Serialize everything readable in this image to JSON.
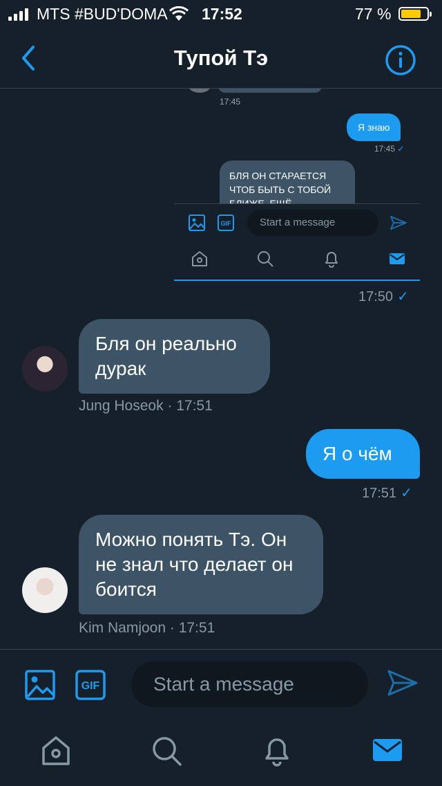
{
  "status_bar": {
    "carrier": "MTS #BUD'DOMA",
    "time": "17:52",
    "battery_percent": "77 %",
    "battery_level": 0.77,
    "signal_bars": 4
  },
  "header": {
    "title": "Тупой Тэ",
    "back_icon": "chevron-left-icon",
    "info_icon": "info-icon"
  },
  "embedded_screenshot": {
    "time_1": "17:45",
    "my_message": "Я знаю",
    "time_2": "17:45",
    "tick": "✓",
    "long_message": "БЛЯ ОН СТАРАЕТСЯ ЧТОБ БЫТЬ С ТОБОЙ БЛИЖЕ. ЕЩЁ",
    "input_placeholder": "Start a message"
  },
  "messages": [
    {
      "time": "17:50",
      "tick": "✓"
    },
    {
      "text": "Бля он реально дурак",
      "meta": "Jung Hoseok · 17:51"
    },
    {
      "text": "Я о чём",
      "time": "17:51",
      "tick": "✓"
    },
    {
      "text": "Можно понять Тэ. Он не знал что делает он боится",
      "meta": "Kim Namjoon · 17:51"
    }
  ],
  "composer": {
    "placeholder": "Start a message",
    "gif_label": "GIF"
  },
  "tabbar": {
    "items": [
      "home-icon",
      "search-icon",
      "bell-icon",
      "mail-icon"
    ],
    "active": "mail-icon"
  },
  "colors": {
    "background": "#15202b",
    "accent": "#1d9bf0",
    "bubble_theirs": "#3d5466",
    "muted": "#8899a6"
  }
}
